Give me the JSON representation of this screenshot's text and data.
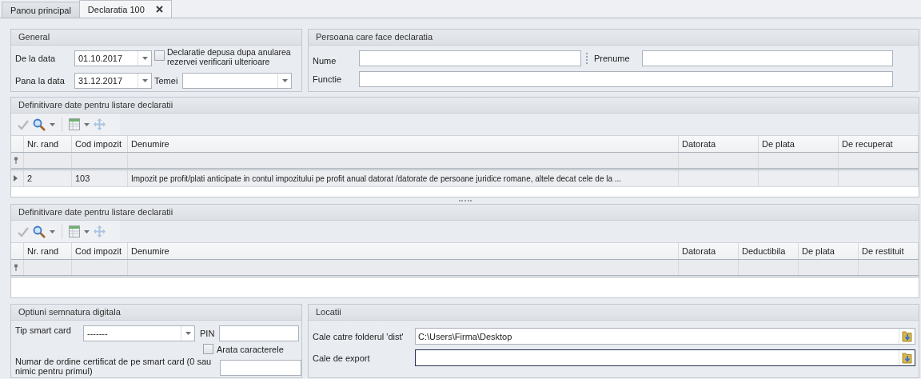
{
  "tabs": [
    {
      "label": "Panou principal",
      "selected": false,
      "closable": false
    },
    {
      "label": "Declaratia 100",
      "selected": true,
      "closable": true
    }
  ],
  "general": {
    "title": "General",
    "from": {
      "label": "De la data",
      "value": "01.10.2017"
    },
    "to": {
      "label": "Pana la data",
      "value": "31.12.2017"
    },
    "checkbox": {
      "label": "Declaratie depusa dupa anularea rezervei verificarii ulterioare",
      "checked": false
    },
    "temei": {
      "label": "Temei"
    }
  },
  "persoana": {
    "title": "Persoana care face declaratia",
    "fields": [
      {
        "label": "Nume"
      },
      {
        "label": "Prenume"
      },
      {
        "label": "Functie"
      }
    ]
  },
  "grids": [
    {
      "title": "Definitivare date pentru listare declaratii",
      "columns": [
        "Nr. rand",
        "Cod impozit",
        "Denumire",
        "Datorata",
        "De plata",
        "De recuperat"
      ],
      "rows": [
        {
          "cells": [
            "2",
            "103",
            "Impozit pe profit/plati anticipate in contul impozitului pe profit anual datorat /datorate de persoane juridice romane, altele decat cele de la ..."
          ],
          "focused": true
        }
      ]
    },
    {
      "title": "Definitivare date pentru listare declaratii",
      "columns": [
        "Nr. rand",
        "Cod impozit",
        "Denumire",
        "Datorata",
        "Deductibila",
        "De plata",
        "De restituit"
      ]
    }
  ],
  "semnatura": {
    "title": "Optiuni semnatura digitala",
    "smart_card": {
      "label": "Tip smart card",
      "value": "-------"
    },
    "pin": {
      "label": "PIN"
    },
    "show_chars": {
      "label": "Arata caracterele",
      "checked": false
    },
    "cert_index": {
      "label": "Numar de ordine certificat de pe smart card (0 sau nimic pentru primul)"
    }
  },
  "locatii": {
    "title": "Locatii",
    "fields": [
      {
        "label": "Cale catre folderul 'dist'",
        "value": "C:\\Users\\Firma\\Desktop",
        "focused": false
      },
      {
        "label": "Cale de export",
        "focused": true
      }
    ]
  }
}
